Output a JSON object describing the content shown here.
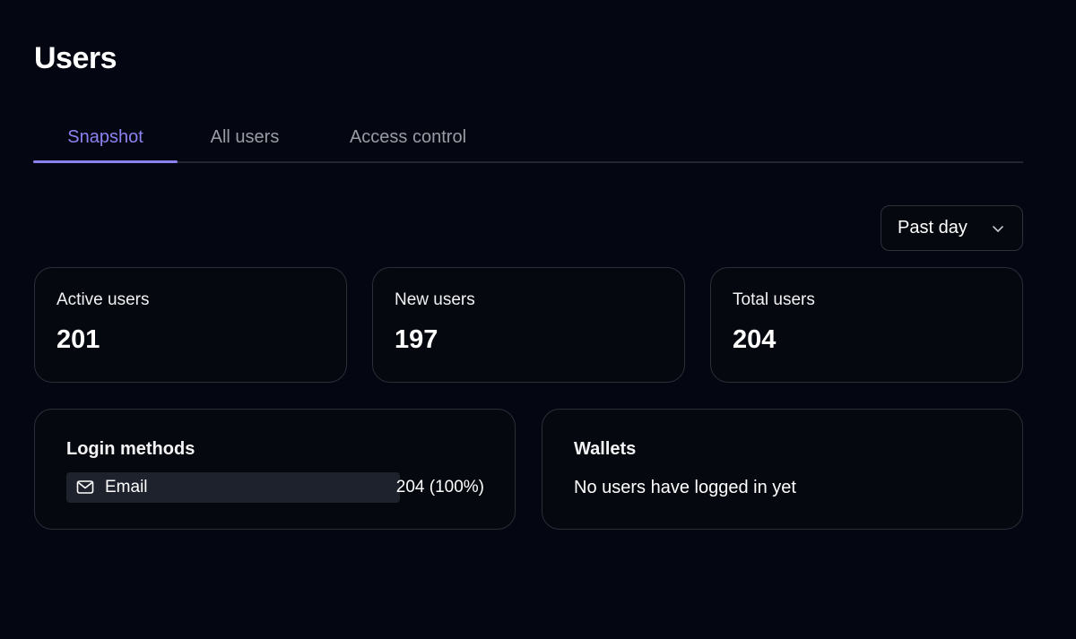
{
  "page": {
    "title": "Users"
  },
  "tabs": [
    {
      "label": "Snapshot",
      "active": true
    },
    {
      "label": "All users",
      "active": false
    },
    {
      "label": "Access control",
      "active": false
    }
  ],
  "period_select": {
    "value": "Past day",
    "icon": "chevron-down-icon"
  },
  "stats": [
    {
      "label": "Active users",
      "value": "201"
    },
    {
      "label": "New users",
      "value": "197"
    },
    {
      "label": "Total users",
      "value": "204"
    }
  ],
  "login_methods": {
    "title": "Login methods",
    "items": [
      {
        "name": "Email",
        "icon": "mail-icon",
        "count": "204 (100%)",
        "share": 1.0
      }
    ]
  },
  "wallets": {
    "title": "Wallets",
    "empty_message": "No users have logged in yet"
  },
  "colors": {
    "background": "#040711",
    "accent": "#8b82f0",
    "border": "#2b2e37",
    "bar": "#1e222c",
    "muted_text": "#9a9ca4"
  }
}
